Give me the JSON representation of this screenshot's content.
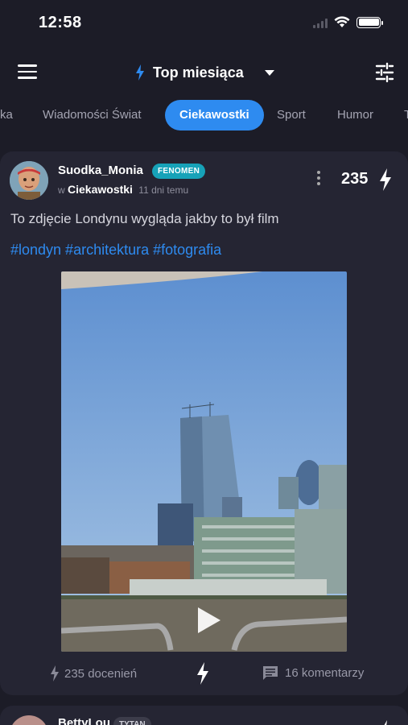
{
  "status_bar": {
    "time": "12:58",
    "battery_level": 1.0
  },
  "header": {
    "title": "Top miesiąca",
    "icons": [
      "menu-icon",
      "bolt-icon",
      "chevron-down-icon",
      "filter-sliders-icon"
    ]
  },
  "tabs": [
    {
      "label": "ka"
    },
    {
      "label": "Wiadomości Świat"
    },
    {
      "label": "Ciekawostki",
      "active": true
    },
    {
      "label": "Sport"
    },
    {
      "label": "Humor"
    },
    {
      "label": "T"
    }
  ],
  "post": {
    "author": "Suodka_Monia",
    "badge": "FENOMEN",
    "in_prefix": "w",
    "category": "Ciekawostki",
    "time_ago": "11 dni temu",
    "score": "235",
    "text": "To zdjęcie Londynu wygląda jakby to był film",
    "tags": "#londyn #architektura #fotografia",
    "reactions_label": "235 docenień",
    "comments_label": "16 komentarzy"
  },
  "next_post": {
    "author": "BettyLou",
    "badge": "TYTAN"
  },
  "colors": {
    "background": "#1c1c27",
    "card": "#252533",
    "accent": "#2e8bf0",
    "badge_fenomen": "#17a2b8"
  }
}
